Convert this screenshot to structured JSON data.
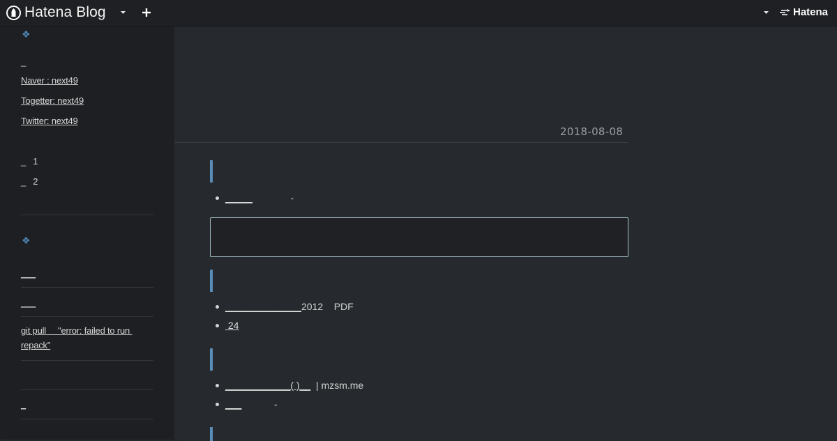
{
  "topbar": {
    "brand": "Hatena Blog",
    "hatena_wordmark": "Hatena",
    "icons": [
      "hatena-blog-logo-icon",
      "chevron-down-icon",
      "plus-icon",
      "chevron-down-icon",
      "hatena-bird-icon"
    ]
  },
  "sidebar": {
    "accent_color": "#4f86b4",
    "heading_icon": "❖",
    "section1": {
      "underscore": "_",
      "links": [
        "Naver   : next49",
        "Togetter: next49",
        "Twitter: next49"
      ],
      "items": [
        "_   1",
        "_   2"
      ]
    },
    "section2": {
      "links": [
        "___",
        "___",
        "git pull     \"error: failed to run repack\"",
        "_"
      ]
    }
  },
  "main": {
    "date": "2018-08-08",
    "accent_color": "#5b8db9",
    "section1_items": [
      {
        "link": "_____",
        "rest": "              -"
      }
    ],
    "section2_items": [
      {
        "link": "______________",
        "rest": "2012    PDF"
      },
      {
        "link": " 24",
        "rest": ""
      }
    ],
    "section3_items": [
      {
        "link": "____________( )__",
        "rest": "  | mzsm.me"
      },
      {
        "link": "___",
        "rest": "            -"
      }
    ]
  }
}
